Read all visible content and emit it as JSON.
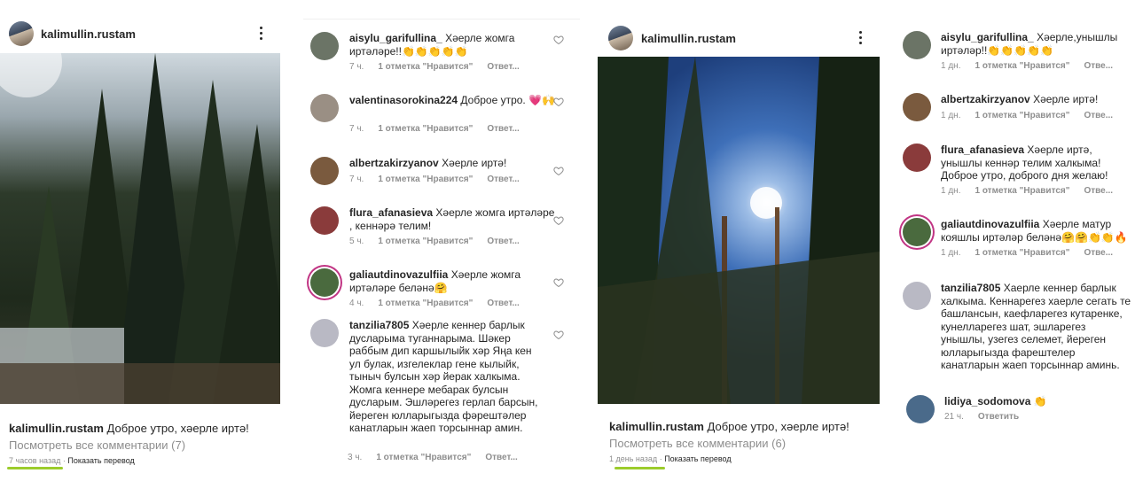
{
  "post1": {
    "username": "kalimullin.rustam",
    "caption_user": "kalimullin.rustam",
    "caption_text": "Доброе утро, хәерле иртә!",
    "view_all": "Посмотреть все комментарии (7)",
    "time": "7 часов назад",
    "translate": "Показать перевод"
  },
  "comments1": [
    {
      "user": "aisylu_garifullina_",
      "text": "Хәерле жомга иртәләре!!👏👏👏👏👏",
      "time": "7 ч.",
      "likes": "1 отметка \"Нравится\"",
      "reply": "Ответ..."
    },
    {
      "user": "valentinasorokina224",
      "text": "Доброе утро. 💗🙌",
      "time": "7 ч.",
      "likes": "1 отметка \"Нравится\"",
      "reply": "Ответ..."
    },
    {
      "user": "albertzakirzyanov",
      "text": "Хәерле иртә!",
      "time": "7 ч.",
      "likes": "1 отметка \"Нравится\"",
      "reply": "Ответ..."
    },
    {
      "user": "flura_afanasieva",
      "text": "Хәерле жомга иртәләре , кеннәрә телим!",
      "time": "5 ч.",
      "likes": "1 отметка \"Нравится\"",
      "reply": "Ответ..."
    },
    {
      "user": "galiautdinovazulfiia",
      "text": "Хәерле жомга иртәләре беләнә🤗",
      "time": "4 ч.",
      "likes": "1 отметка \"Нравится\"",
      "reply": "Ответ..."
    },
    {
      "user": "tanzilia7805",
      "text": "Хәерле кеннер барлык дусларыма туганнарыма. Шәкер раббым дип каршылыйк хәр Яңа кен ул булак, изгелеклар гене кылыйк, тыныч булсын хәр йерак халкыма. Жомга кеннере мебарак булсын дусларым. Эшләрегез герлап барсын, йереген юлларыгызда фәрештәлер канатларын жаеп торсыннар амин.",
      "time": "3 ч.",
      "likes": "1 отметка \"Нравится\"",
      "reply": "Ответ..."
    }
  ],
  "post2": {
    "username": "kalimullin.rustam",
    "caption_user": "kalimullin.rustam",
    "caption_text": "Доброе утро, хәерле иртә!",
    "view_all": "Посмотреть все комментарии (6)",
    "time": "1 день назад",
    "translate": "Показать перевод"
  },
  "comments2": [
    {
      "user": "aisylu_garifullina_",
      "text": "Хәерле,унышлы иртәләр!!👏👏👏👏👏",
      "time": "1 дн.",
      "likes": "1 отметка \"Нравится\"",
      "reply": "Отве..."
    },
    {
      "user": "albertzakirzyanov",
      "text": "Хәерле иртә!",
      "time": "1 дн.",
      "likes": "1 отметка \"Нравится\"",
      "reply": "Отве..."
    },
    {
      "user": "flura_afanasieva",
      "text": "Хәерле иртә, унышлы кеннәр телим халкыма! Доброе утро, доброго дня желаю!",
      "time": "1 дн.",
      "likes": "1 отметка \"Нравится\"",
      "reply": "Отве..."
    },
    {
      "user": "galiautdinovazulfiia",
      "text": "Хәерле матур кояшлы иртәләр беләнә🤗🤗👏👏🔥",
      "time": "1 дн.",
      "likes": "1 отметка \"Нравится\"",
      "reply": "Отве..."
    },
    {
      "user": "tanzilia7805",
      "text": "Хаерле кеннер барлык халкыма. Кеннарегез хаерле сегать те башлансын, каефларегез кутаренке, кунелларегез шат, эшларегез унышлы, узегез селемет, йереген юлларыгызда фарештелер канатларын жаеп торсыннар аминь.",
      "time": "",
      "likes": "",
      "reply": ""
    },
    {
      "user": "lidiya_sodomova",
      "text": "👏",
      "time": "21 ч.",
      "likes": "",
      "reply": "Ответить"
    }
  ],
  "colors": {
    "accent_underline": "#9ccc2c",
    "muted": "#8e8e8e",
    "text": "#262626"
  },
  "icons": {
    "more": "more-vertical-icon",
    "heart": "heart-outline-icon"
  }
}
